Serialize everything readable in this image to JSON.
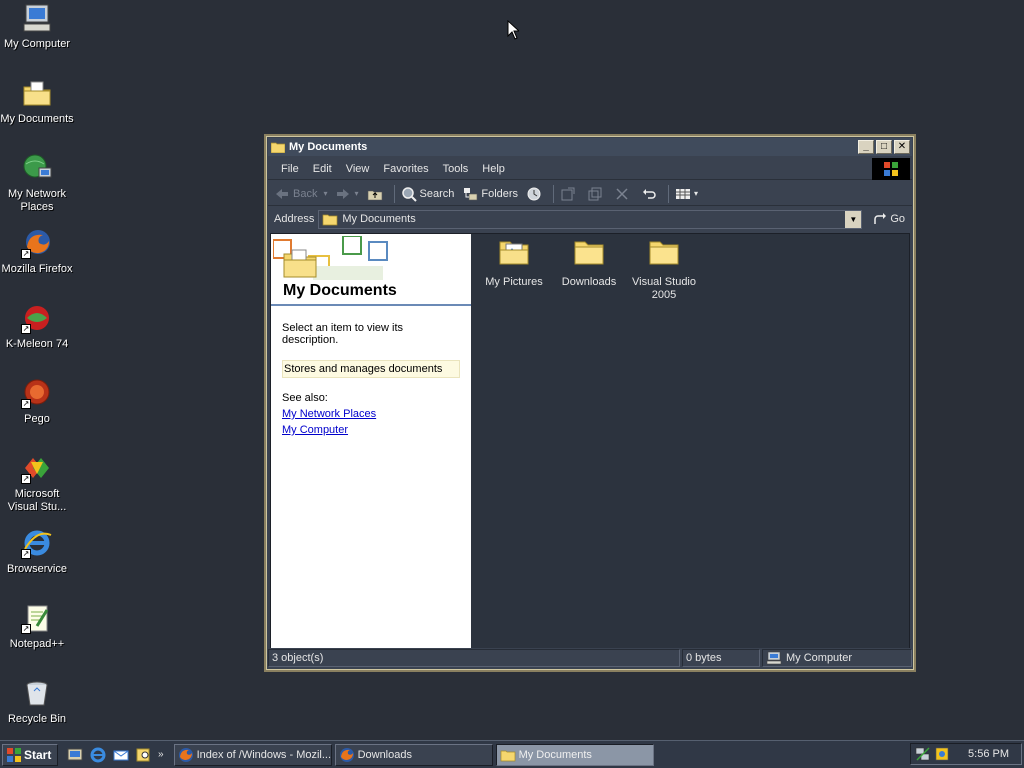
{
  "desktop": {
    "icons": [
      {
        "label": "My Computer"
      },
      {
        "label": "My Documents"
      },
      {
        "label": "My Network Places"
      },
      {
        "label": "Mozilla Firefox"
      },
      {
        "label": "K-Meleon 74"
      },
      {
        "label": "Pego"
      },
      {
        "label": "Microsoft Visual Stu..."
      },
      {
        "label": "Browservice"
      },
      {
        "label": "Notepad++"
      },
      {
        "label": "Recycle Bin"
      }
    ]
  },
  "window": {
    "title": "My Documents",
    "menu": [
      "File",
      "Edit",
      "View",
      "Favorites",
      "Tools",
      "Help"
    ],
    "toolbar": {
      "back": "Back",
      "search": "Search",
      "folders": "Folders"
    },
    "address": {
      "label": "Address",
      "value": "My Documents",
      "go": "Go"
    },
    "taskpane": {
      "title": "My Documents",
      "description": "Select an item to view its description.",
      "info": "Stores and manages documents",
      "see_also": "See also:",
      "links": [
        "My Network Places",
        "My Computer"
      ]
    },
    "files": [
      {
        "name": "My Pictures",
        "icon": "pictures-folder-icon"
      },
      {
        "name": "Downloads",
        "icon": "folder-icon"
      },
      {
        "name": "Visual Studio 2005",
        "icon": "folder-icon"
      }
    ],
    "status": {
      "objects": "3 object(s)",
      "size": "0 bytes",
      "zone": "My Computer"
    }
  },
  "taskbar": {
    "start": "Start",
    "tasks": [
      {
        "label": "Index of /Windows - Mozil...",
        "active": false
      },
      {
        "label": "Downloads",
        "active": false
      },
      {
        "label": "My Documents",
        "active": true
      }
    ],
    "clock": "5:56 PM"
  },
  "colors": {
    "desktop_bg": "#2a2f38",
    "window_bg": "#3a4250",
    "content_bg": "#2c333e",
    "link": "#0000cc"
  }
}
